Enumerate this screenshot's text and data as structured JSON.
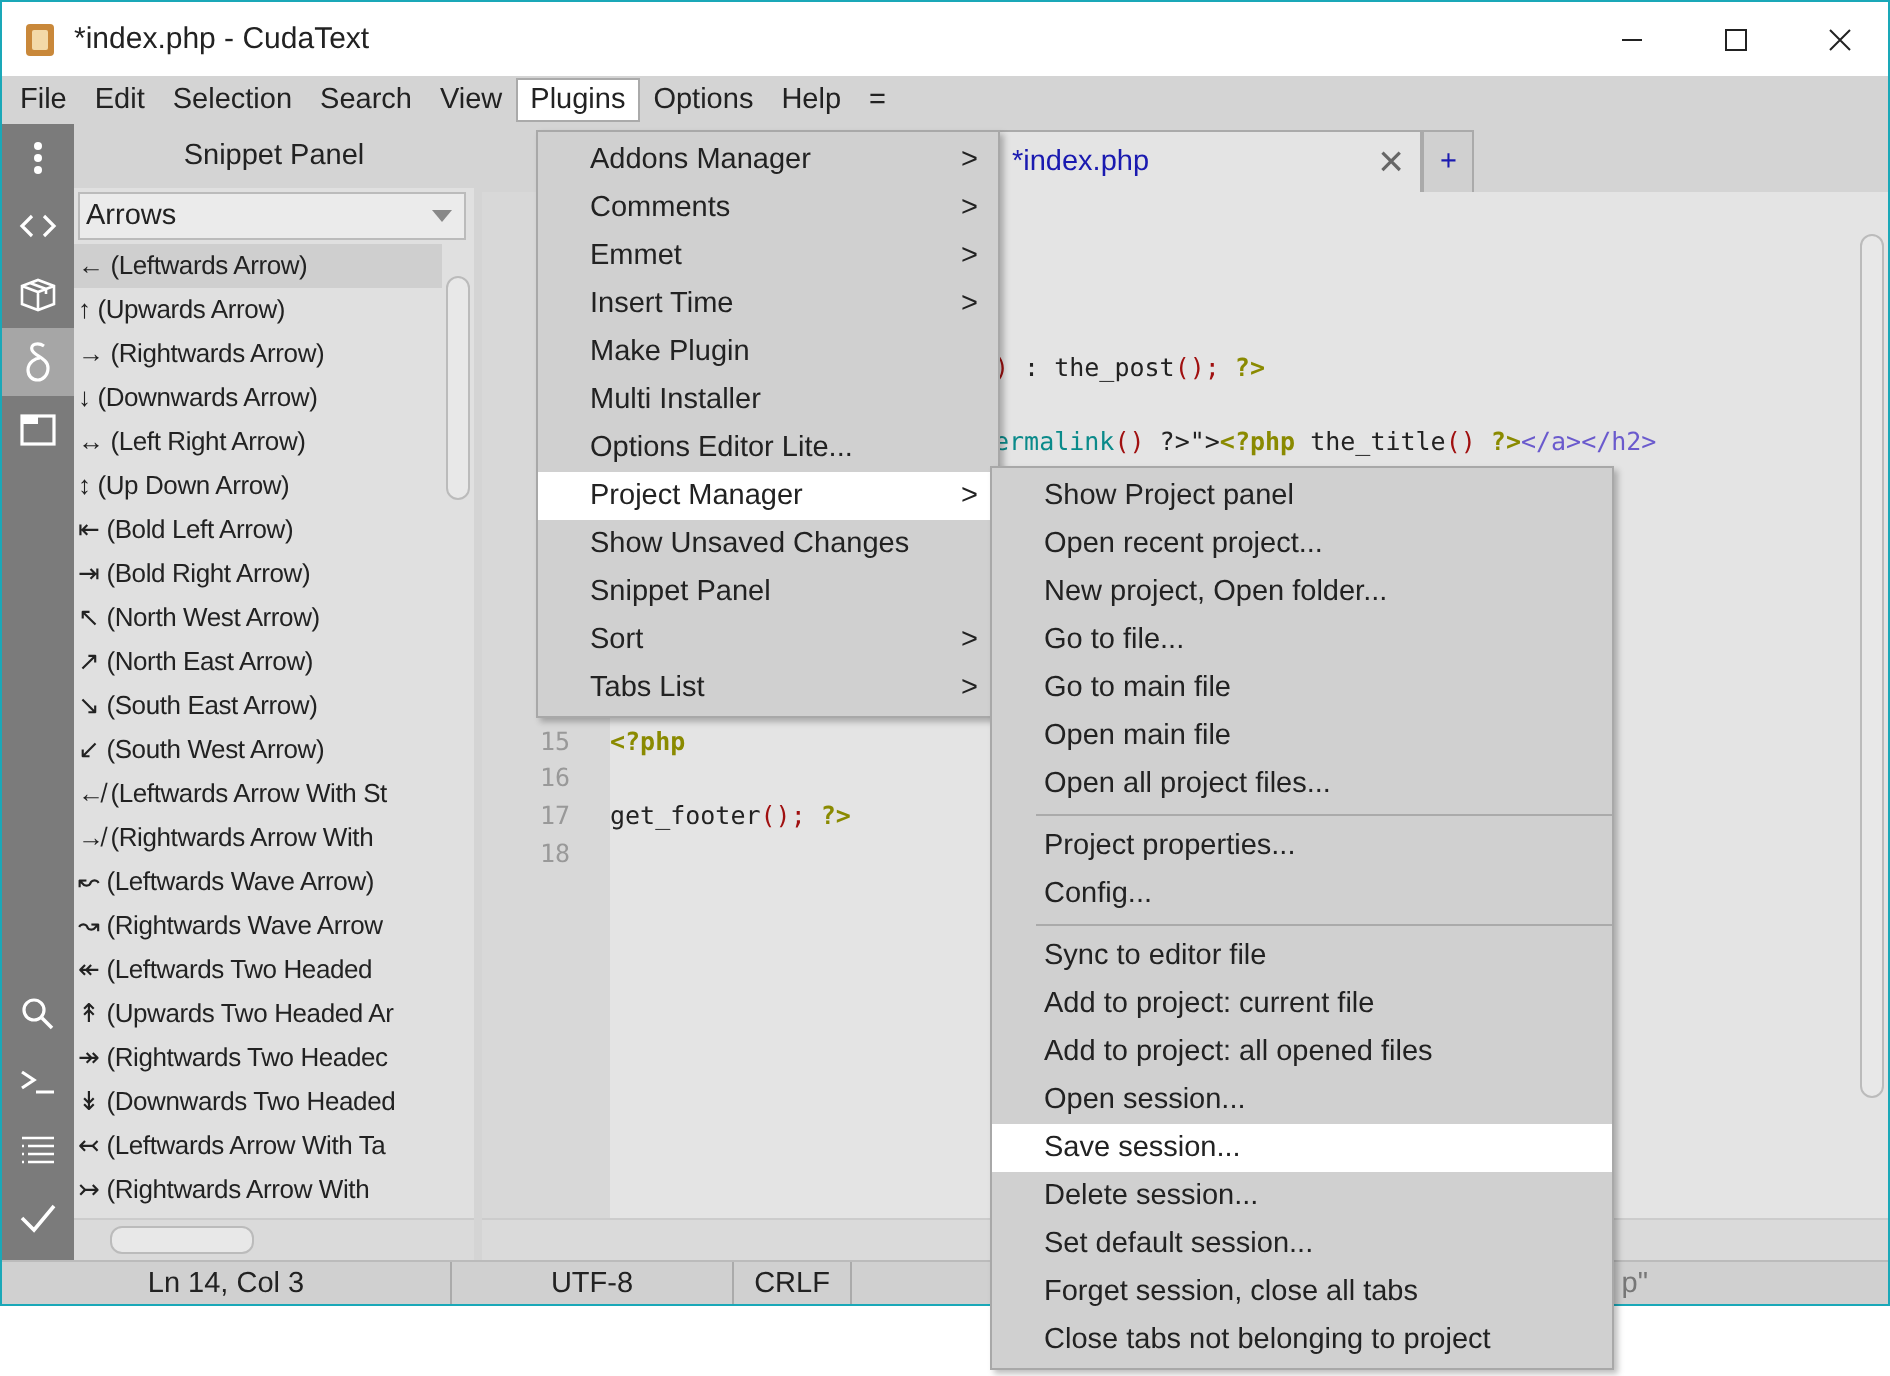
{
  "window": {
    "title": "*index.php - CudaText"
  },
  "menubar": [
    {
      "label": "File",
      "selected": false
    },
    {
      "label": "Edit",
      "selected": false
    },
    {
      "label": "Selection",
      "selected": false
    },
    {
      "label": "Search",
      "selected": false
    },
    {
      "label": "View",
      "selected": false
    },
    {
      "label": "Plugins",
      "selected": true
    },
    {
      "label": "Options",
      "selected": false
    },
    {
      "label": "Help",
      "selected": false
    },
    {
      "label": "=",
      "selected": false
    }
  ],
  "sidebar": {
    "top": [
      {
        "kind": "dots",
        "selected": false
      },
      {
        "kind": "code",
        "selected": false
      },
      {
        "kind": "box",
        "selected": false
      },
      {
        "kind": "delta",
        "selected": true
      },
      {
        "kind": "window",
        "selected": false
      }
    ],
    "bottom": [
      {
        "kind": "search",
        "selected": false
      },
      {
        "kind": "terminal",
        "selected": false
      },
      {
        "kind": "list",
        "selected": false
      },
      {
        "kind": "check",
        "selected": false
      }
    ]
  },
  "snippet_panel": {
    "title": "Snippet Panel",
    "category": "Arrows",
    "items": [
      {
        "label": "← (Leftwards Arrow)",
        "selected": true
      },
      {
        "label": "↑ (Upwards Arrow)",
        "selected": false
      },
      {
        "label": "→ (Rightwards Arrow)",
        "selected": false
      },
      {
        "label": "↓ (Downwards Arrow)",
        "selected": false
      },
      {
        "label": "↔ (Left Right Arrow)",
        "selected": false
      },
      {
        "label": "↕ (Up Down Arrow)",
        "selected": false
      },
      {
        "label": "⇤ (Bold Left Arrow)",
        "selected": false
      },
      {
        "label": "⇥ (Bold Right Arrow)",
        "selected": false
      },
      {
        "label": "↖ (North West Arrow)",
        "selected": false
      },
      {
        "label": "↗ (North East Arrow)",
        "selected": false
      },
      {
        "label": "↘ (South East Arrow)",
        "selected": false
      },
      {
        "label": "↙ (South West Arrow)",
        "selected": false
      },
      {
        "label": "↚ (Leftwards Arrow With St",
        "selected": false
      },
      {
        "label": "↛ (Rightwards Arrow With",
        "selected": false
      },
      {
        "label": "↜ (Leftwards Wave Arrow)",
        "selected": false
      },
      {
        "label": "↝ (Rightwards Wave Arrow",
        "selected": false
      },
      {
        "label": "↞ (Leftwards Two Headed",
        "selected": false
      },
      {
        "label": "↟ (Upwards Two Headed Ar",
        "selected": false
      },
      {
        "label": "↠ (Rightwards Two Headec",
        "selected": false
      },
      {
        "label": "↡ (Downwards Two Headed",
        "selected": false
      },
      {
        "label": "↢ (Leftwards Arrow With Ta",
        "selected": false
      },
      {
        "label": "↣ (Rightwards Arrow With",
        "selected": false
      }
    ]
  },
  "tabs": [
    {
      "label": "*index.php",
      "selected": true,
      "close": "×"
    },
    {
      "label": "+",
      "selected": false
    }
  ],
  "editor": {
    "lines": [
      {
        "kind": "continued",
        "tokens": [
          {
            "kind": "paren",
            "text": ")"
          },
          {
            "kind": "plain",
            "text": " : the_post"
          },
          {
            "kind": "paren",
            "text": "();"
          },
          {
            "kind": "php",
            "text": " ?>"
          }
        ]
      },
      {
        "kind": "continued",
        "tokens": [
          {
            "kind": "func",
            "text": "ermalink"
          },
          {
            "kind": "paren",
            "text": "()"
          },
          {
            "kind": "plain",
            "text": " ?>\">"
          },
          {
            "kind": "php",
            "text": "<?php"
          },
          {
            "kind": "plain",
            "text": " the_title"
          },
          {
            "kind": "paren",
            "text": "()"
          },
          {
            "kind": "php",
            "text": " ?>"
          },
          {
            "kind": "tag",
            "text": "</a></h2>"
          }
        ]
      },
      {
        "number": "15",
        "tokens": [
          {
            "kind": "php",
            "text": "<?php"
          }
        ]
      },
      {
        "number": "16"
      },
      {
        "number": "17",
        "tokens": [
          {
            "kind": "plain",
            "text": "get_footer"
          },
          {
            "kind": "paren",
            "text": "();"
          },
          {
            "kind": "php",
            "text": " ?>"
          }
        ]
      },
      {
        "number": "18"
      }
    ]
  },
  "plugins_menu": [
    {
      "label": "Addons Manager",
      "submenu": true,
      "selected": false
    },
    {
      "label": "Comments",
      "submenu": true,
      "selected": false
    },
    {
      "label": "Emmet",
      "submenu": true,
      "selected": false
    },
    {
      "label": "Insert Time",
      "submenu": true,
      "selected": false
    },
    {
      "label": "Make Plugin",
      "submenu": false,
      "selected": false
    },
    {
      "label": "Multi Installer",
      "submenu": false,
      "selected": false
    },
    {
      "label": "Options Editor Lite...",
      "submenu": false,
      "selected": false
    },
    {
      "label": "Project Manager",
      "submenu": true,
      "selected": true
    },
    {
      "label": "Show Unsaved Changes",
      "submenu": false,
      "selected": false
    },
    {
      "label": "Snippet Panel",
      "submenu": false,
      "selected": false
    },
    {
      "label": "Sort",
      "submenu": true,
      "selected": false
    },
    {
      "label": "Tabs List",
      "submenu": true,
      "selected": false
    }
  ],
  "submenu_arrow": ">",
  "project_menu": [
    {
      "kind": "item",
      "label": "Show Project panel",
      "selected": false
    },
    {
      "kind": "item",
      "label": "Open recent project...",
      "selected": false
    },
    {
      "kind": "item",
      "label": "New project, Open folder...",
      "selected": false
    },
    {
      "kind": "item",
      "label": "Go to file...",
      "selected": false
    },
    {
      "kind": "item",
      "label": "Go to main file",
      "selected": false
    },
    {
      "kind": "item",
      "label": "Open main file",
      "selected": false
    },
    {
      "kind": "item",
      "label": "Open all project files...",
      "selected": false
    },
    {
      "kind": "separator"
    },
    {
      "kind": "item",
      "label": "Project properties...",
      "selected": false
    },
    {
      "kind": "item",
      "label": "Config...",
      "selected": false
    },
    {
      "kind": "separator"
    },
    {
      "kind": "item",
      "label": "Sync to editor file",
      "selected": false
    },
    {
      "kind": "item",
      "label": "Add to project: current file",
      "selected": false
    },
    {
      "kind": "item",
      "label": "Add to project: all opened files",
      "selected": false
    },
    {
      "kind": "item",
      "label": "Open session...",
      "selected": false
    },
    {
      "kind": "item",
      "label": "Save session...",
      "selected": true
    },
    {
      "kind": "item",
      "label": "Delete session...",
      "selected": false
    },
    {
      "kind": "item",
      "label": "Set default session...",
      "selected": false
    },
    {
      "kind": "item",
      "label": "Forget session, close all tabs",
      "selected": false
    },
    {
      "kind": "item",
      "label": "Close tabs not belonging to project",
      "selected": false
    }
  ],
  "status_bar": [
    "Ln 14, Col 3",
    "UTF-8",
    "CRLF",
    "p\""
  ]
}
